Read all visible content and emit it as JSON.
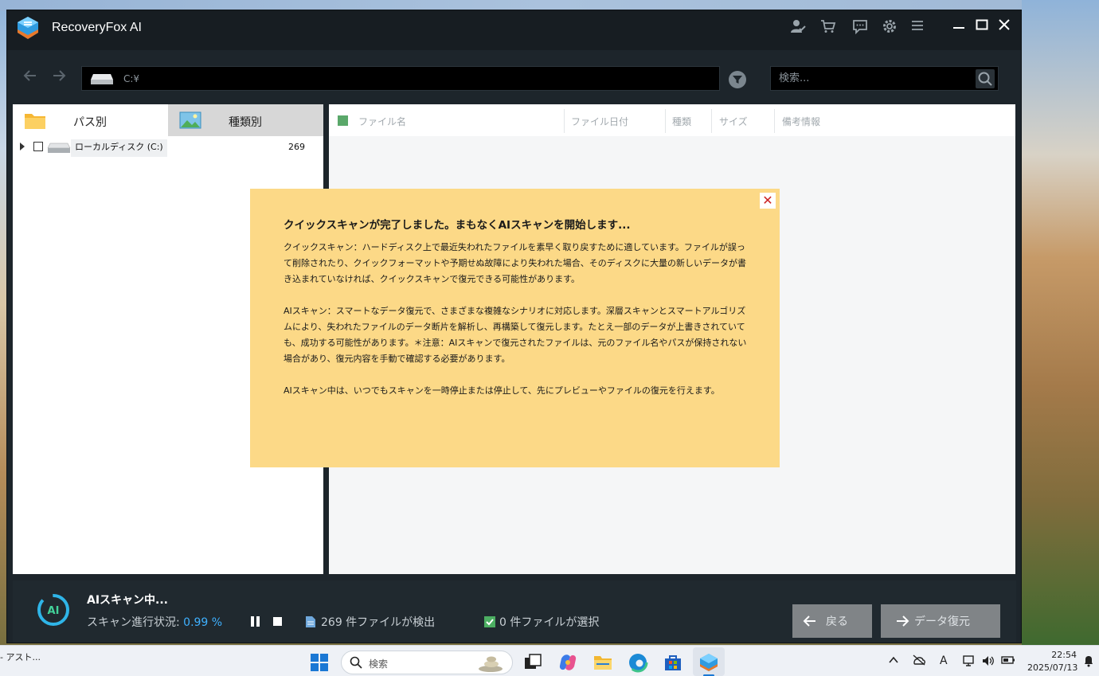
{
  "app": {
    "title": "RecoveryFox AI"
  },
  "toolbar": {
    "path": "C:¥",
    "search_placeholder": "検索..."
  },
  "left_panel": {
    "tabs": [
      {
        "label": "パス別",
        "active": true
      },
      {
        "label": "種類別",
        "active": false
      }
    ],
    "tree": [
      {
        "label": "ローカルディスク (C:)",
        "count": "269"
      }
    ]
  },
  "table": {
    "columns": [
      "ファイル名",
      "ファイル日付",
      "種類",
      "サイズ",
      "備考情報"
    ]
  },
  "dialog": {
    "title": "クイックスキャンが完了しました。まもなくAIスキャンを開始します...",
    "para1": "クイックスキャン：ハードディスク上で最近失われたファイルを素早く取り戻すために適しています。ファイルが誤って削除されたり、クイックフォーマットや予期せぬ故障により失われた場合、そのディスクに大量の新しいデータが書き込まれていなければ、クイックスキャンで復元できる可能性があります。",
    "para2": "AIスキャン：スマートなデータ復元で、さまざまな複雑なシナリオに対応します。深層スキャンとスマートアルゴリズムにより、失われたファイルのデータ断片を解析し、再構築して復元します。たとえ一部のデータが上書きされていても、成功する可能性があります。＊注意：AIスキャンで復元されたファイルは、元のファイル名やパスが保持されない場合があり、復元内容を手動で確認する必要があります。",
    "para3": "AIスキャン中は、いつでもスキャンを一時停止または停止して、先にプレビューやファイルの復元を行えます。",
    "close_symbol": "✕"
  },
  "status": {
    "scan_title": "AIスキャン中...",
    "progress_label": "スキャン進行状況:",
    "progress_value": "0.99 %",
    "found_text": "269 件ファイルが検出",
    "selected_text": "0 件ファイルが選択",
    "back_label": "戻る",
    "recover_label": "データ復元"
  },
  "taskbar": {
    "left_text": "- アスト...",
    "search_label": "検索",
    "time": "22:54",
    "date": "2025/07/13",
    "ime": "A"
  },
  "colors": {
    "dialog_bg": "#fcd987",
    "accent_blue": "#3fb1ff",
    "window_bg": "#1d252b"
  }
}
